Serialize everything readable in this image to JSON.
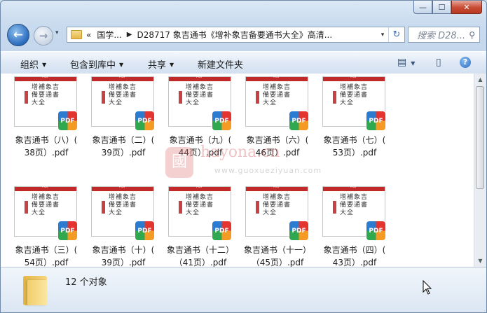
{
  "window": {
    "caption_buttons": {
      "minimize": "—",
      "maximize": "☐",
      "close": "✕"
    }
  },
  "nav": {
    "back_glyph": "←",
    "forward_glyph": "→",
    "history_glyph": "▾",
    "address": {
      "overflow": "«",
      "crumbs": [
        "国学...",
        "D28717 象吉通书《增补象吉备要通书大全》高清..."
      ],
      "dropdown_glyph": "▾",
      "refresh_glyph": "↻"
    },
    "search": {
      "placeholder": "搜索 D28...",
      "icon": "search-icon"
    }
  },
  "toolbar": {
    "organize": "组织",
    "include_in_library": "包含到库中",
    "share": "共享",
    "new_folder": "新建文件夹",
    "dropdown_glyph": "▼",
    "view_glyph": "▤",
    "preview_glyph": "▯",
    "help_glyph": "?"
  },
  "files": [
    {
      "line1": "象吉通书（八）(",
      "line2": "38页）.pdf"
    },
    {
      "line1": "象吉通书（二）(",
      "line2": "39页）.pdf"
    },
    {
      "line1": "象吉通书（九）(",
      "line2": "44页）.pdf"
    },
    {
      "line1": "象吉通书（六）(",
      "line2": "46页）.pdf"
    },
    {
      "line1": "象吉通书（七）(",
      "line2": "53页）.pdf"
    },
    {
      "line1": "象吉通书（三）(",
      "line2": "54页）.pdf"
    },
    {
      "line1": "象吉通书（十）(",
      "line2": "39页）.pdf"
    },
    {
      "line1": "象吉通书（十二）",
      "line2": "（41页）.pdf"
    },
    {
      "line1": "象吉通书（十一）",
      "line2": "（45页）.pdf"
    },
    {
      "line1": "象吉通书（四）(",
      "line2": "43页）.pdf"
    }
  ],
  "thumbnail": {
    "pdf_tag": "PDF",
    "cover_title": "增補象吉備要通書大全",
    "badge": "PDF"
  },
  "watermark": {
    "logo": "國",
    "brand": "hayona.cn",
    "url": "www.guoxueziyuan.com"
  },
  "status": {
    "item_count": "12 个对象"
  }
}
